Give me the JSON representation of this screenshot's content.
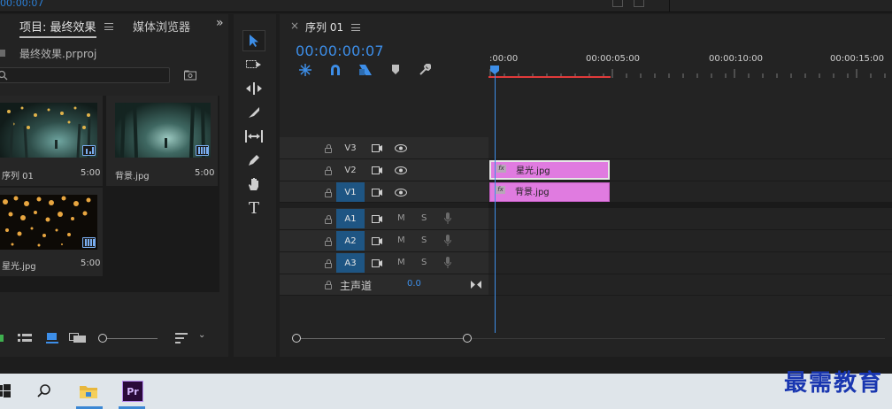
{
  "top": {
    "timecode": "00:00:07"
  },
  "project": {
    "tab_project": "项目: 最终效果",
    "tab_media": "媒体浏览器",
    "file_name": "最终效果.prproj",
    "items": [
      {
        "name": "序列 01",
        "duration": "5:00"
      },
      {
        "name": "背景.jpg",
        "duration": "5:00"
      },
      {
        "name": "星光.jpg",
        "duration": "5:00"
      }
    ]
  },
  "sequence": {
    "tab": "序列 01",
    "timecode": "00:00:00:07",
    "ruler_labels": [
      ":00:00",
      "00:00:05:00",
      "00:00:10:00",
      "00:00:15:00"
    ],
    "video_tracks": [
      "V3",
      "V2",
      "V1"
    ],
    "audio_tracks": [
      "A1",
      "A2",
      "A3"
    ],
    "mute_label": "M",
    "solo_label": "S",
    "master_label": "主声道",
    "master_value": "0.0",
    "clips": [
      {
        "track": "V2",
        "name": "星光.jpg"
      },
      {
        "track": "V1",
        "name": "背景.jpg"
      }
    ]
  },
  "watermark": "最需教育",
  "colors": {
    "accent": "#3d8ee8",
    "clip": "#e07be0",
    "track_on": "#1e5583",
    "playhead": "#3d8ee8",
    "work_area": "#e03a3a"
  }
}
